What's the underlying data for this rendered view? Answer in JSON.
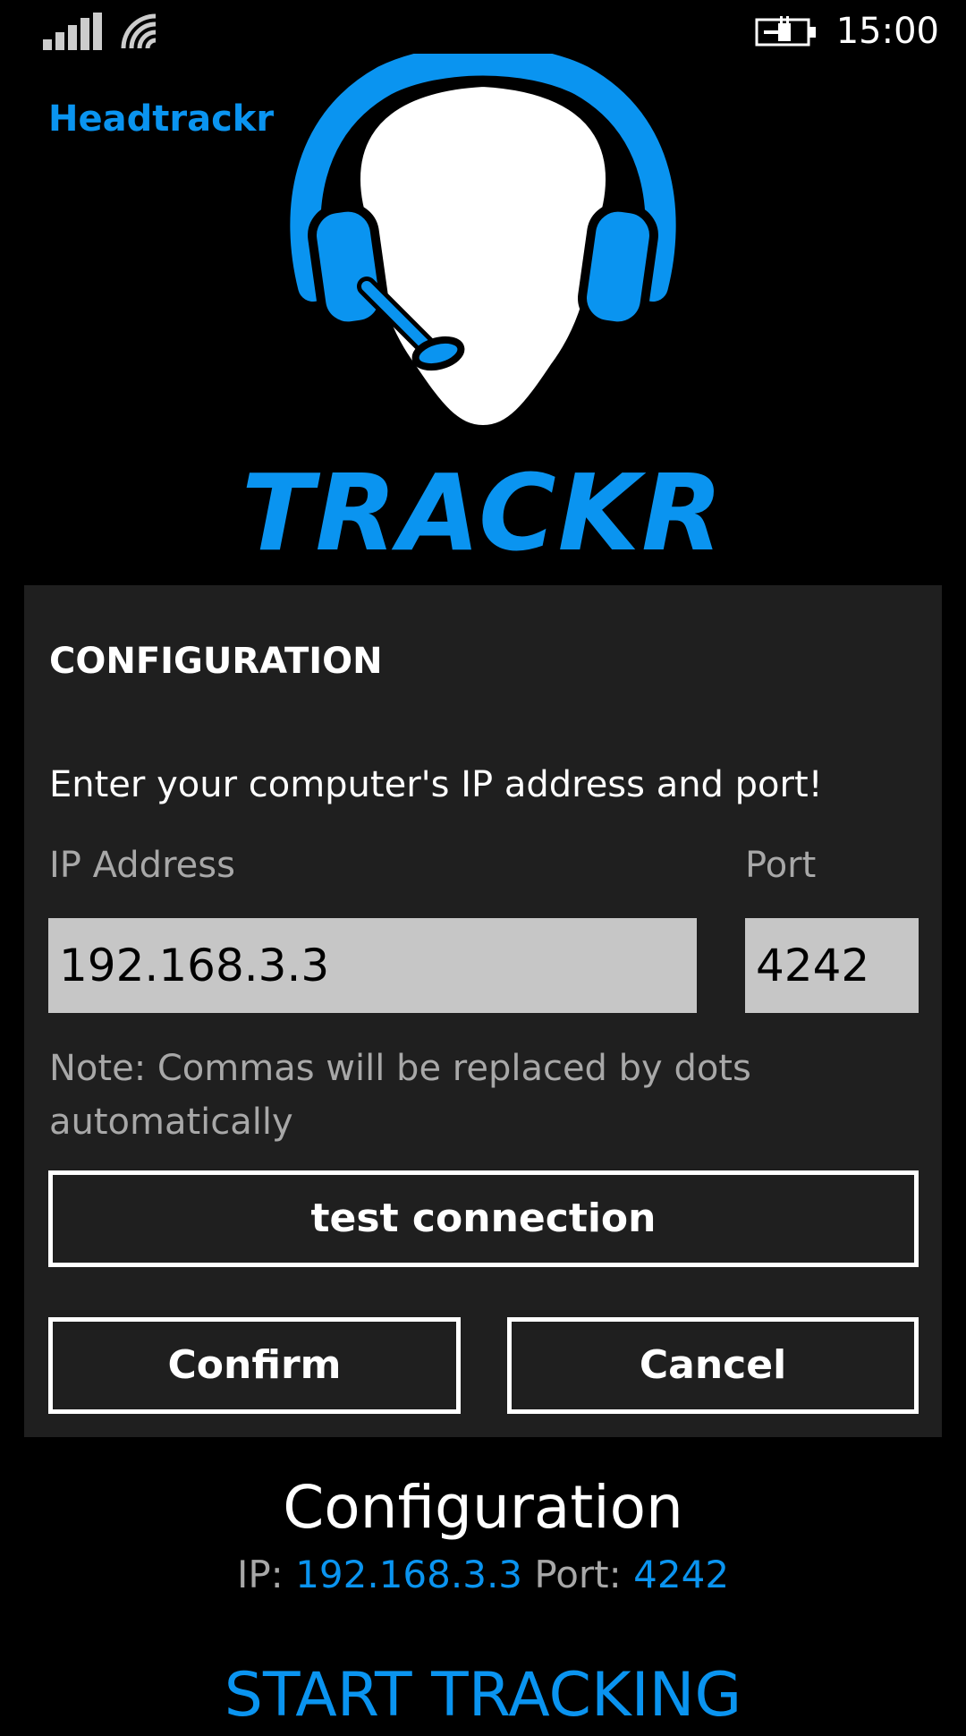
{
  "status_bar": {
    "signal_icon": "signal-bars-icon",
    "wifi_icon": "wifi-icon",
    "battery_icon": "battery-charging-icon",
    "time": "15:00"
  },
  "app": {
    "title": "Headtrackr",
    "brand": "TRACKR",
    "logo_icon": "head-with-headset-icon"
  },
  "dialog": {
    "title": "CONFIGURATION",
    "prompt": "Enter your computer's IP address and port!",
    "ip_label": "IP Address",
    "ip_value": "192.168.3.3",
    "port_label": "Port",
    "port_value": "4242",
    "note": "Note: Commas will be replaced by dots automatically",
    "test_button": "test connection",
    "confirm_button": "Confirm",
    "cancel_button": "Cancel"
  },
  "summary": {
    "title": "Configuration",
    "ip_prefix": "IP:",
    "ip_value": "192.168.3.3",
    "port_prefix": "Port:",
    "port_value": "4242"
  },
  "start_button": "START TRACKING",
  "colors": {
    "accent": "#0a94f0",
    "background": "#000000",
    "dialog_background": "#1f1f1f",
    "input_background": "#c6c6c6",
    "secondary_text": "#a8a8a8"
  }
}
